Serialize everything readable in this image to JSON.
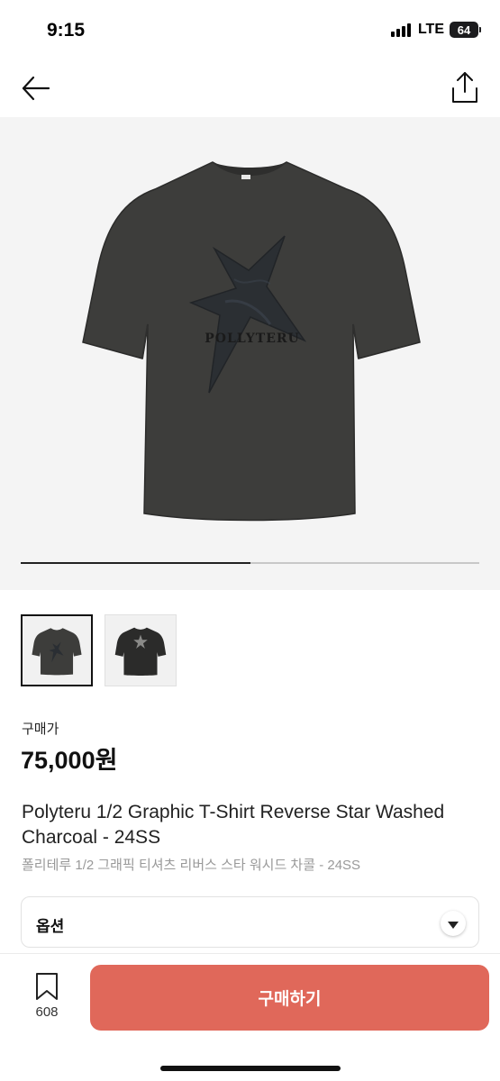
{
  "status": {
    "time": "9:15",
    "network": "LTE",
    "battery": "64"
  },
  "nav": {
    "back_icon": "arrow-left-icon",
    "share_icon": "share-icon"
  },
  "gallery": {
    "progress": 0.5,
    "print_text": "POLLYTERU",
    "thumbnails": [
      {
        "selected": true
      },
      {
        "selected": false
      }
    ]
  },
  "product": {
    "price_label": "구매가",
    "price": "75,000원",
    "title_en": "Polyteru 1/2 Graphic T-Shirt Reverse Star Washed Charcoal - 24SS",
    "title_ko": "폴리테루 1/2 그래픽 티셔츠 리버스 스타 워시드 차콜 - 24SS"
  },
  "option": {
    "label": "옵션"
  },
  "bottom": {
    "wish_count": "608",
    "buy_label": "구매하기",
    "buy_color": "#e0685a"
  }
}
